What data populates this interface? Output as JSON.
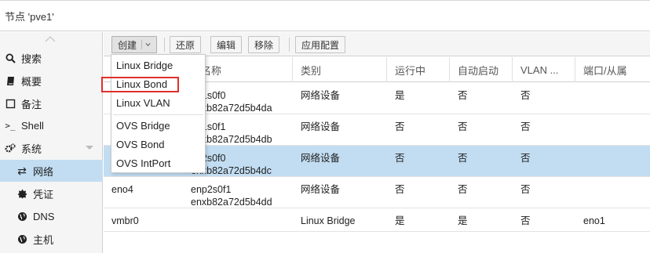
{
  "header": {
    "title": "节点 'pve1'"
  },
  "sidebar": {
    "items": [
      {
        "label": "搜索",
        "icon": "search-icon"
      },
      {
        "label": "概要",
        "icon": "book-icon"
      },
      {
        "label": "备注",
        "icon": "notes-icon"
      },
      {
        "label": "Shell",
        "icon": "terminal-icon"
      },
      {
        "label": "系统",
        "icon": "gears-icon"
      },
      {
        "label": "网络",
        "icon": "network-icon"
      },
      {
        "label": "凭证",
        "icon": "certificate-icon"
      },
      {
        "label": "DNS",
        "icon": "globe-icon"
      },
      {
        "label": "主机",
        "icon": "globe-icon"
      }
    ],
    "active": "网络"
  },
  "toolbar": {
    "create_label": "创建",
    "revert_label": "还原",
    "edit_label": "编辑",
    "remove_label": "移除",
    "apply_label": "应用配置"
  },
  "menu": {
    "items": [
      "Linux Bridge",
      "Linux Bond",
      "Linux VLAN",
      "OVS Bridge",
      "OVS Bond",
      "OVS IntPort"
    ],
    "highlighted": "Linux Bond"
  },
  "grid": {
    "headers": [
      "名称",
      "替代名称",
      "类别",
      "运行中",
      "自动启动",
      "VLAN ...",
      "端口/从属"
    ],
    "header_visible": {
      "alt": "链名称"
    },
    "rows": [
      {
        "name": "",
        "alt1": "np1s0f0",
        "alt2": "enxb82a72d5b4da",
        "type": "网络设备",
        "running": "是",
        "autostart": "否",
        "vlan": "否",
        "ports": ""
      },
      {
        "name": "",
        "alt1": "np1s0f1",
        "alt2": "enxb82a72d5b4db",
        "type": "网络设备",
        "running": "否",
        "autostart": "否",
        "vlan": "否",
        "ports": ""
      },
      {
        "name": "",
        "alt1": "np2s0f0",
        "alt2": "enxb82a72d5b4dc",
        "type": "网络设备",
        "running": "否",
        "autostart": "否",
        "vlan": "否",
        "ports": ""
      },
      {
        "name": "eno4",
        "alt1": "enp2s0f1",
        "alt2": "enxb82a72d5b4dd",
        "type": "网络设备",
        "running": "否",
        "autostart": "否",
        "vlan": "否",
        "ports": ""
      },
      {
        "name": "vmbr0",
        "alt1": "",
        "alt2": "",
        "type": "Linux Bridge",
        "running": "是",
        "autostart": "是",
        "vlan": "否",
        "ports": "eno1"
      }
    ]
  },
  "colors": {
    "selected_row": "#c2ddf2",
    "highlight_box": "#e0302a",
    "sidebar_bg": "#f5f5f5"
  }
}
